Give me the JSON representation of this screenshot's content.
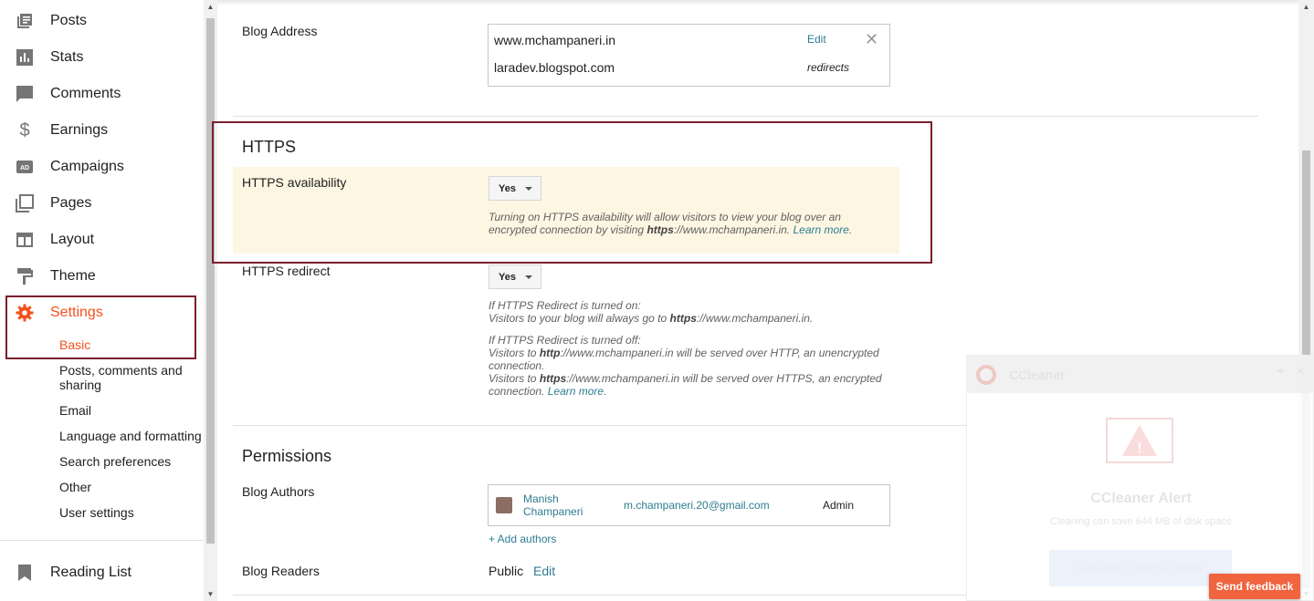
{
  "sidebar": {
    "items": [
      {
        "label": "Posts",
        "icon": "posts-icon"
      },
      {
        "label": "Stats",
        "icon": "stats-icon"
      },
      {
        "label": "Comments",
        "icon": "comments-icon"
      },
      {
        "label": "Earnings",
        "icon": "dollar-icon"
      },
      {
        "label": "Campaigns",
        "icon": "ad-icon"
      },
      {
        "label": "Pages",
        "icon": "pages-icon"
      },
      {
        "label": "Layout",
        "icon": "layout-icon"
      },
      {
        "label": "Theme",
        "icon": "paint-roller-icon"
      },
      {
        "label": "Settings",
        "icon": "gear-icon"
      }
    ],
    "settings_sub": [
      {
        "label": "Basic"
      },
      {
        "label": "Posts, comments and sharing"
      },
      {
        "label": "Email"
      },
      {
        "label": "Language and formatting"
      },
      {
        "label": "Search preferences"
      },
      {
        "label": "Other"
      },
      {
        "label": "User settings"
      }
    ],
    "reading_list": "Reading List",
    "accent_color": "#f4511e"
  },
  "blog_address": {
    "label": "Blog Address",
    "primary": "www.mchampaneri.in",
    "edit": "Edit",
    "secondary": "laradev.blogspot.com",
    "redirects": "redirects"
  },
  "https": {
    "title": "HTTPS",
    "availability_label": "HTTPS availability",
    "availability_value": "Yes",
    "availability_help_1": "Turning on HTTPS availability will allow visitors to view your blog over an encrypted connection by visiting ",
    "availability_help_bold": "https",
    "availability_help_2": "://www.mchampaneri.in. ",
    "learn_more": "Learn more.",
    "redirect_label": "HTTPS redirect",
    "redirect_value": "Yes",
    "redirect_on_heading": "If HTTPS Redirect is turned on:",
    "redirect_on_1": "Visitors to your blog will always go to ",
    "redirect_on_bold": "https",
    "redirect_on_2": "://www.mchampaneri.in.",
    "redirect_off_heading": "If HTTPS Redirect is turned off:",
    "redirect_off_a1": "Visitors to ",
    "redirect_off_a_bold": "http",
    "redirect_off_a2": "://www.mchampaneri.in will be served over HTTP, an unencrypted connection.",
    "redirect_off_b1": "Visitors to ",
    "redirect_off_b_bold": "https",
    "redirect_off_b2": "://www.mchampaneri.in will be served over HTTPS, an encrypted connection. ",
    "redirect_learn_more": "Learn more."
  },
  "permissions": {
    "title": "Permissions",
    "authors_label": "Blog Authors",
    "author_name_1": "Manish",
    "author_name_2": "Champaneri",
    "author_email": "m.champaneri.20@gmail.com",
    "author_role": "Admin",
    "add_authors": "+ Add authors",
    "readers_label": "Blog Readers",
    "readers_value": "Public",
    "readers_edit": "Edit"
  },
  "ccleaner": {
    "title": "CCleaner",
    "alert_title": "CCleaner Alert",
    "alert_body": "Cleaning can save 644 MB of disk space",
    "button": "Click here to open CCleaner"
  },
  "feedback": "Send feedback",
  "colors": {
    "link": "#2e7d91",
    "highlight": "#fdf6e2",
    "annotation_box": "#7b1f2c"
  }
}
